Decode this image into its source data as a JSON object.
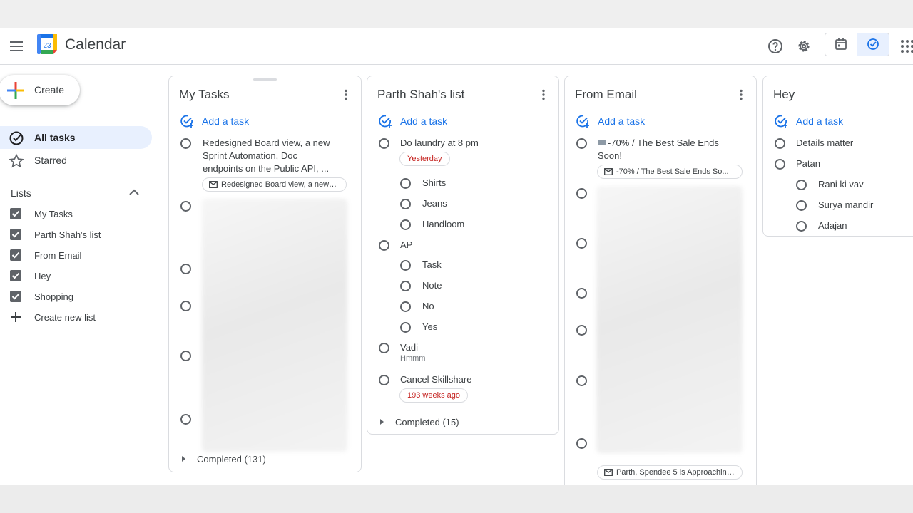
{
  "header": {
    "app_title": "Calendar",
    "logo_day": "23",
    "icons": [
      "menu-icon",
      "help-icon",
      "settings-icon",
      "calendar-view-icon",
      "tasks-view-icon",
      "apps-grid-icon"
    ]
  },
  "sidebar": {
    "create_label": "Create",
    "nav": [
      {
        "label": "All tasks",
        "icon": "all-tasks-icon",
        "active": true
      },
      {
        "label": "Starred",
        "icon": "star-icon",
        "active": false
      }
    ],
    "lists_title": "Lists",
    "lists": [
      "My Tasks",
      "Parth Shah's list",
      "From Email",
      "Hey",
      "Shopping"
    ],
    "create_list_label": "Create new list"
  },
  "columns": {
    "my_tasks": {
      "title": "My Tasks",
      "add_task": "Add a task",
      "task1": "Redesigned Board view, a new Sprint Automation, Doc endpoints on the Public API, ...",
      "task1_line1": "Redesigned Board view, a new",
      "task1_line2": "Sprint Automation, Doc",
      "task1_line3": "endpoints on the Public API, ...",
      "task1_chip": "Redesigned Board view, a new S...",
      "completed": "Completed (131)"
    },
    "parth": {
      "title": "Parth Shah's list",
      "add_task": "Add a task",
      "t1": "Do laundry at 8 pm",
      "t1_due": "Yesterday",
      "t1_subs": [
        "Shirts",
        "Jeans",
        "Handloom"
      ],
      "t2": "AP",
      "t2_subs": [
        "Task",
        "Note",
        "No",
        "Yes"
      ],
      "t3": "Vadi",
      "t3_note": "Hmmm",
      "t4": "Cancel Skillshare",
      "t4_due": "193 weeks ago",
      "completed": "Completed (15)"
    },
    "from_email": {
      "title": "From Email",
      "add_task": "Add a task",
      "t1_line1": "-70% / The Best Sale Ends",
      "t1_line2": "Soon!",
      "t1_chip": "-70% / The Best Sale Ends So...",
      "bottom_chip": "Parth, Spendee 5 is Approaching..."
    },
    "hey": {
      "title": "Hey",
      "add_task": "Add a task",
      "t1": "Details matter",
      "t2": "Patan",
      "t2_subs": [
        "Rani ki vav",
        "Surya mandir",
        "Adajan"
      ]
    }
  },
  "colors": {
    "accent": "#1a73e8",
    "active_nav_bg": "#e8f0fe",
    "due_red": "#c5221f",
    "text": "#3c4043"
  }
}
